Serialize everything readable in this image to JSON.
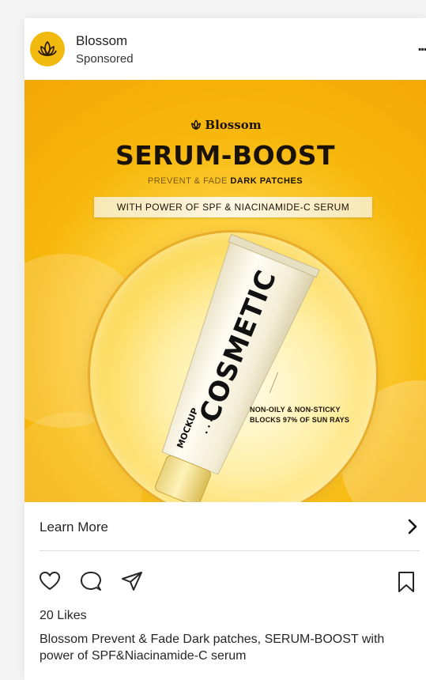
{
  "post": {
    "account_name": "Blossom",
    "sponsored_label": "Sponsored",
    "more_label": "..."
  },
  "ad": {
    "logo_text": "Blossom",
    "headline": "SERUM-BOOST",
    "subline_prefix": "PREVENT & FADE ",
    "subline_bold": "DARK PATCHES",
    "banner": "WITH POWER OF SPF & NIACINAMIDE-C SERUM",
    "tube_brand": "COSMETIC",
    "tube_dots": "• • •",
    "tube_sub": "MOCKUP",
    "claim_1": "NON-OILY & NON-STICKY",
    "claim_2": "BLOCKS 97% OF SUN RAYS",
    "colors": {
      "accent": "#f2b90f",
      "dark": "#1b1206"
    }
  },
  "cta": {
    "label": "Learn More"
  },
  "engagement": {
    "likes": "20 Likes",
    "caption": "Blossom Prevent & Fade Dark patches, SERUM-BOOST with power of SPF&Niacinamide-C serum"
  },
  "icons": [
    "lotus-logo-icon",
    "more-icon",
    "chevron-right-icon",
    "heart-icon",
    "comment-icon",
    "share-icon",
    "bookmark-icon"
  ]
}
